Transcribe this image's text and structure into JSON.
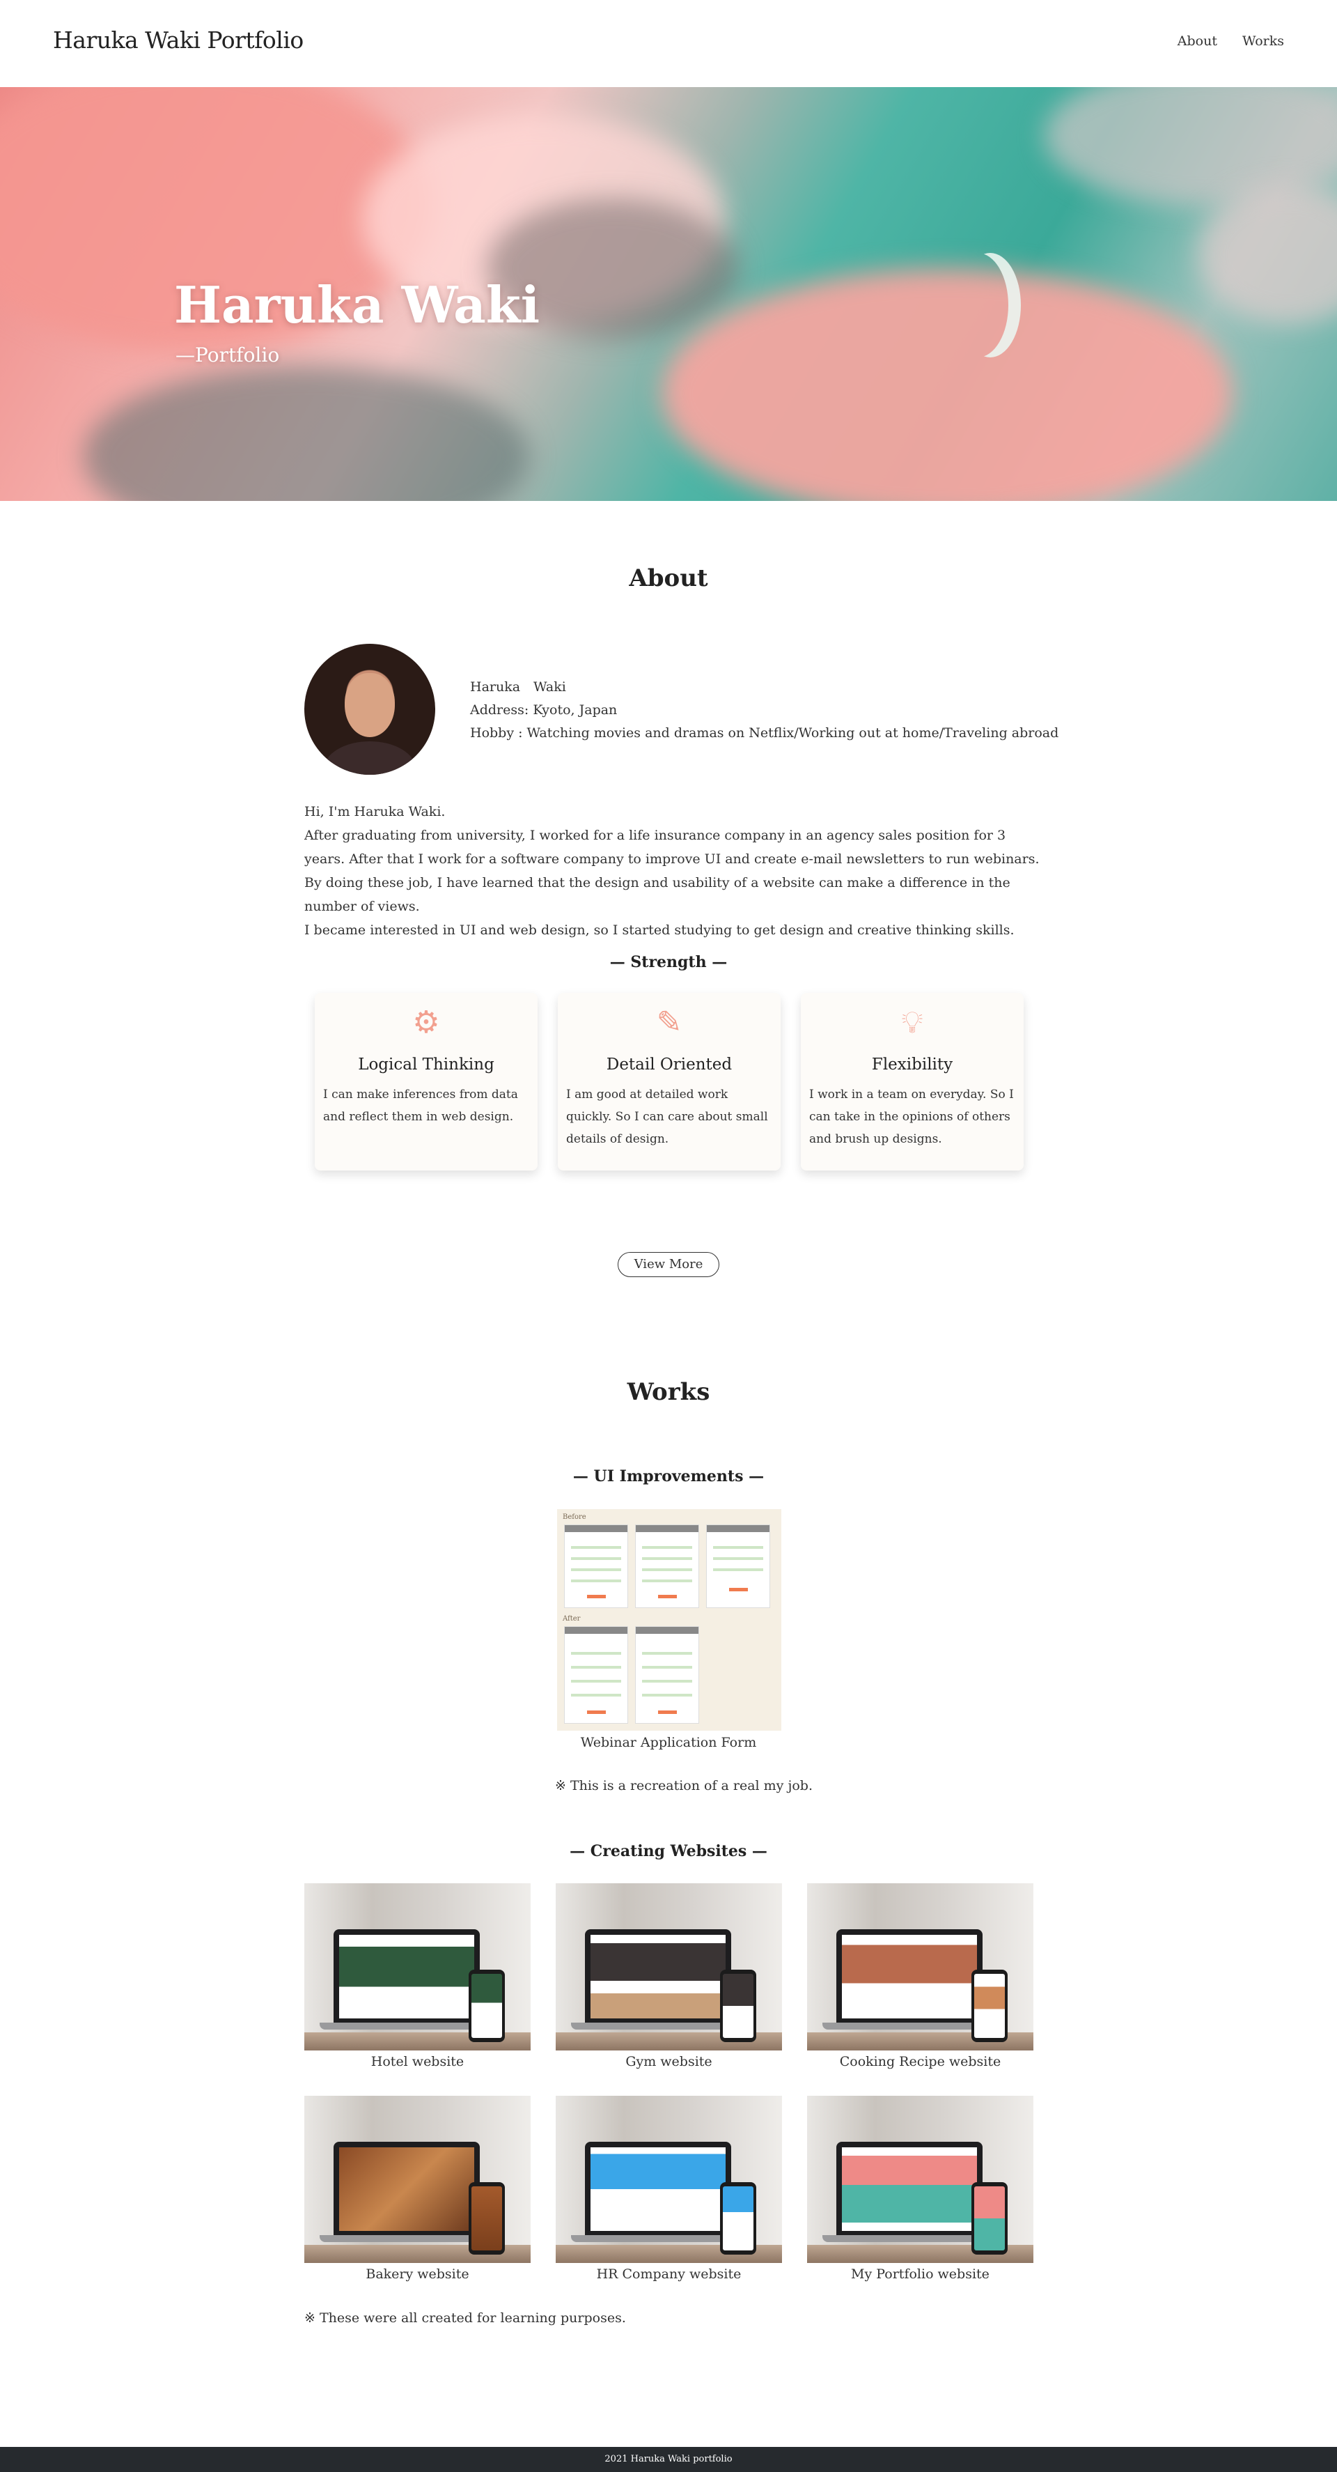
{
  "header": {
    "logo": "Haruka Waki Portfolio",
    "nav": [
      "About",
      "Works"
    ]
  },
  "hero": {
    "title": "Haruka Waki",
    "subtitle": "—Portfolio"
  },
  "about": {
    "heading": "About",
    "name": "Haruka　Waki",
    "address": "Address: Kyoto, Japan",
    "hobby": "Hobby : Watching movies and dramas on Netflix/Working out at home/Traveling abroad",
    "bio": [
      "Hi, I'm Haruka Waki.",
      "After graduating from university, I worked for a life insurance company in an agency sales position for 3 years. After that I work for a software company to improve UI and create e-mail newsletters to run webinars.",
      "By doing these job, I have learned that the design and usability of a website can make a difference in the number of views.",
      "I became interested in UI and web design, so I started studying to get design and creative thinking skills."
    ],
    "strength_heading": "— Strength —",
    "strengths": [
      {
        "icon": "gears-icon",
        "title": "Logical Thinking",
        "desc": "I can make inferences from data and reflect them in web design."
      },
      {
        "icon": "edit-icon",
        "title": "Detail Oriented",
        "desc": "I am good at detailed work quickly. So I can care about small details of design."
      },
      {
        "icon": "lightbulb-icon",
        "title": "Flexibility",
        "desc": "I work in a team on everyday. So I can take in the opinions of others and brush up designs."
      }
    ],
    "view_more": "View More"
  },
  "works": {
    "heading": "Works",
    "ui_heading": "— UI Improvements —",
    "ui_thumb": {
      "before": "Before",
      "after": "After"
    },
    "ui_caption": "Webinar Application Form",
    "ui_note": "※ This is a recreation of a real my job.",
    "sites_heading": "— Creating Websites —",
    "sites": [
      "Hotel website",
      "Gym website",
      "Cooking Recipe website",
      "Bakery website",
      "HR Company website",
      "My Portfolio website"
    ],
    "sites_note": "※ These were all created for learning purposes."
  },
  "footer": {
    "text": "2021 Haruka Waki portfolio"
  },
  "colors": {
    "accent": "#f2a08f",
    "footer_bg": "#262a2e",
    "hero_pink": "#ee8a87",
    "hero_teal": "#3ba999"
  }
}
